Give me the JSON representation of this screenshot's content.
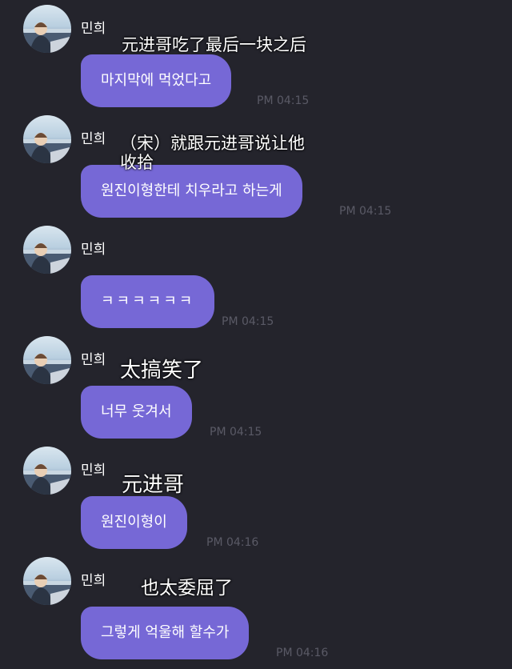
{
  "messages": [
    {
      "sender": "민희",
      "caption": "元进哥吃了最后一块之后",
      "text": "마지막에 먹었다고",
      "time": "PM 04:15"
    },
    {
      "sender": "민희",
      "caption": "（宋）就跟元进哥说让他\n收拾",
      "text": "원진이형한테 치우라고 하는게",
      "time": "PM 04:15"
    },
    {
      "sender": "민희",
      "caption": "",
      "text": "ㅋㅋㅋㅋㅋㅋ",
      "time": "PM 04:15"
    },
    {
      "sender": "민희",
      "caption": "太搞笑了",
      "text": "너무 웃겨서",
      "time": "PM 04:15"
    },
    {
      "sender": "민희",
      "caption": "元进哥",
      "text": "원진이형이",
      "time": "PM 04:16"
    },
    {
      "sender": "민희",
      "caption": "也太委屈了",
      "text": "그렇게 억울해 할수가",
      "time": "PM 04:16"
    }
  ],
  "colors": {
    "background": "#24242c",
    "bubble": "#7668d6",
    "text": "#ffffff",
    "time": "#5a5a66"
  },
  "icons": {
    "avatar": "profile-photo-avatar"
  }
}
